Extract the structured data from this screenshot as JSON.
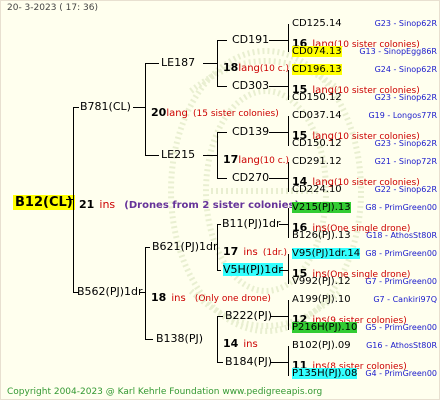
{
  "header": {
    "date": "20-  3-2023 (  17: 36)"
  },
  "footer": {
    "copyright": "Copyright 2004-2023 @ Karl Kehrle Foundation    www.pedigreeapis.org"
  },
  "root": {
    "name": "B12(CL)",
    "gen_number": "21",
    "gen_type": "ins",
    "note": "(Drones from 2 sister colonies)"
  },
  "level1": [
    {
      "name": "B781(CL)",
      "gen_number": "20",
      "gen_type": "lang",
      "note": "(15 sister colonies)"
    },
    {
      "name": "B562(PJ)1dr",
      "gen_number": "18",
      "gen_type": "ins",
      "note": "(Only one drone)"
    }
  ],
  "level2": [
    {
      "name": "LE187",
      "gen_number": "18",
      "gen_type": "lang",
      "note": "(10 c.)"
    },
    {
      "name": "LE215",
      "gen_number": "17",
      "gen_type": "lang",
      "note": "(10 c.)"
    },
    {
      "name": "B621(PJ)1dr",
      "gen_number": "17",
      "gen_type": "ins",
      "note": "(1dr.)"
    },
    {
      "name": "B138(PJ)",
      "gen_number": "14",
      "gen_type": "ins",
      "note": ""
    }
  ],
  "level3": [
    {
      "name": "CD191",
      "gen_number": "16",
      "gen_type": "lang",
      "note": "(10 sister colonies)"
    },
    {
      "name": "CD303",
      "gen_number": "15",
      "gen_type": "lang",
      "note": "(10 sister colonies)"
    },
    {
      "name": "CD139",
      "gen_number": "15",
      "gen_type": "lang",
      "note": "(10 sister colonies)"
    },
    {
      "name": "CD270",
      "gen_number": "14",
      "gen_type": "lang",
      "note": "(10 sister colonies)"
    },
    {
      "name": "B11(PJ)1dr",
      "gen_number": "16",
      "gen_type": "ins",
      "note": "(One single drone)"
    },
    {
      "name": "V5H(PJ)1dr",
      "gen_number": "15",
      "gen_type": "ins",
      "note": "(One single drone)"
    },
    {
      "name": "B222(PJ)",
      "gen_number": "12",
      "gen_type": "ins",
      "note": "(9 sister colonies)"
    },
    {
      "name": "B184(PJ)",
      "gen_number": "11",
      "gen_type": "ins",
      "note": "(8 sister colonies)"
    }
  ],
  "level4": [
    {
      "name": "CD125.14",
      "meta": "G23 - Sinop62R"
    },
    {
      "name": "CD074.13",
      "meta": "G13 - SinopEgg86R"
    },
    {
      "name": "CD196.13",
      "meta": "G24 - Sinop62R"
    },
    {
      "name": "CD150.12",
      "meta": "G23 - Sinop62R"
    },
    {
      "name": "CD037.14",
      "meta": "G19 - Longos77R"
    },
    {
      "name": "CD150.12",
      "meta": "G23 - Sinop62R"
    },
    {
      "name": "CD291.12",
      "meta": "G21 - Sinop72R"
    },
    {
      "name": "CD224.10",
      "meta": "G22 - Sinop62R"
    },
    {
      "name": "V215(PJ).13",
      "meta": "G8 - PrimGreen00"
    },
    {
      "name": "B126(PJ).13",
      "meta": "G18 - AthosSt80R"
    },
    {
      "name": "V95(PJ)1dr.14",
      "meta": "G8 - PrimGreen00"
    },
    {
      "name": "V992(PJ).12",
      "meta": "G7 - PrimGreen00"
    },
    {
      "name": "A199(PJ).10",
      "meta": "G7 - Cankiri97Q"
    },
    {
      "name": "P216H(PJ).10",
      "meta": "G5 - PrimGreen00"
    },
    {
      "name": "B102(PJ).09",
      "meta": "G16 - AthosSt80R"
    },
    {
      "name": "P135H(PJ).08",
      "meta": "G4 - PrimGreen00"
    }
  ],
  "colors": {
    "background": "#ffffee",
    "highlight_yellow": "#ffff00",
    "highlight_green": "#33cc33",
    "highlight_cyan": "#33ffff",
    "gen_type": "#cc0000",
    "meta": "#1a1acc",
    "footer": "#339933"
  }
}
